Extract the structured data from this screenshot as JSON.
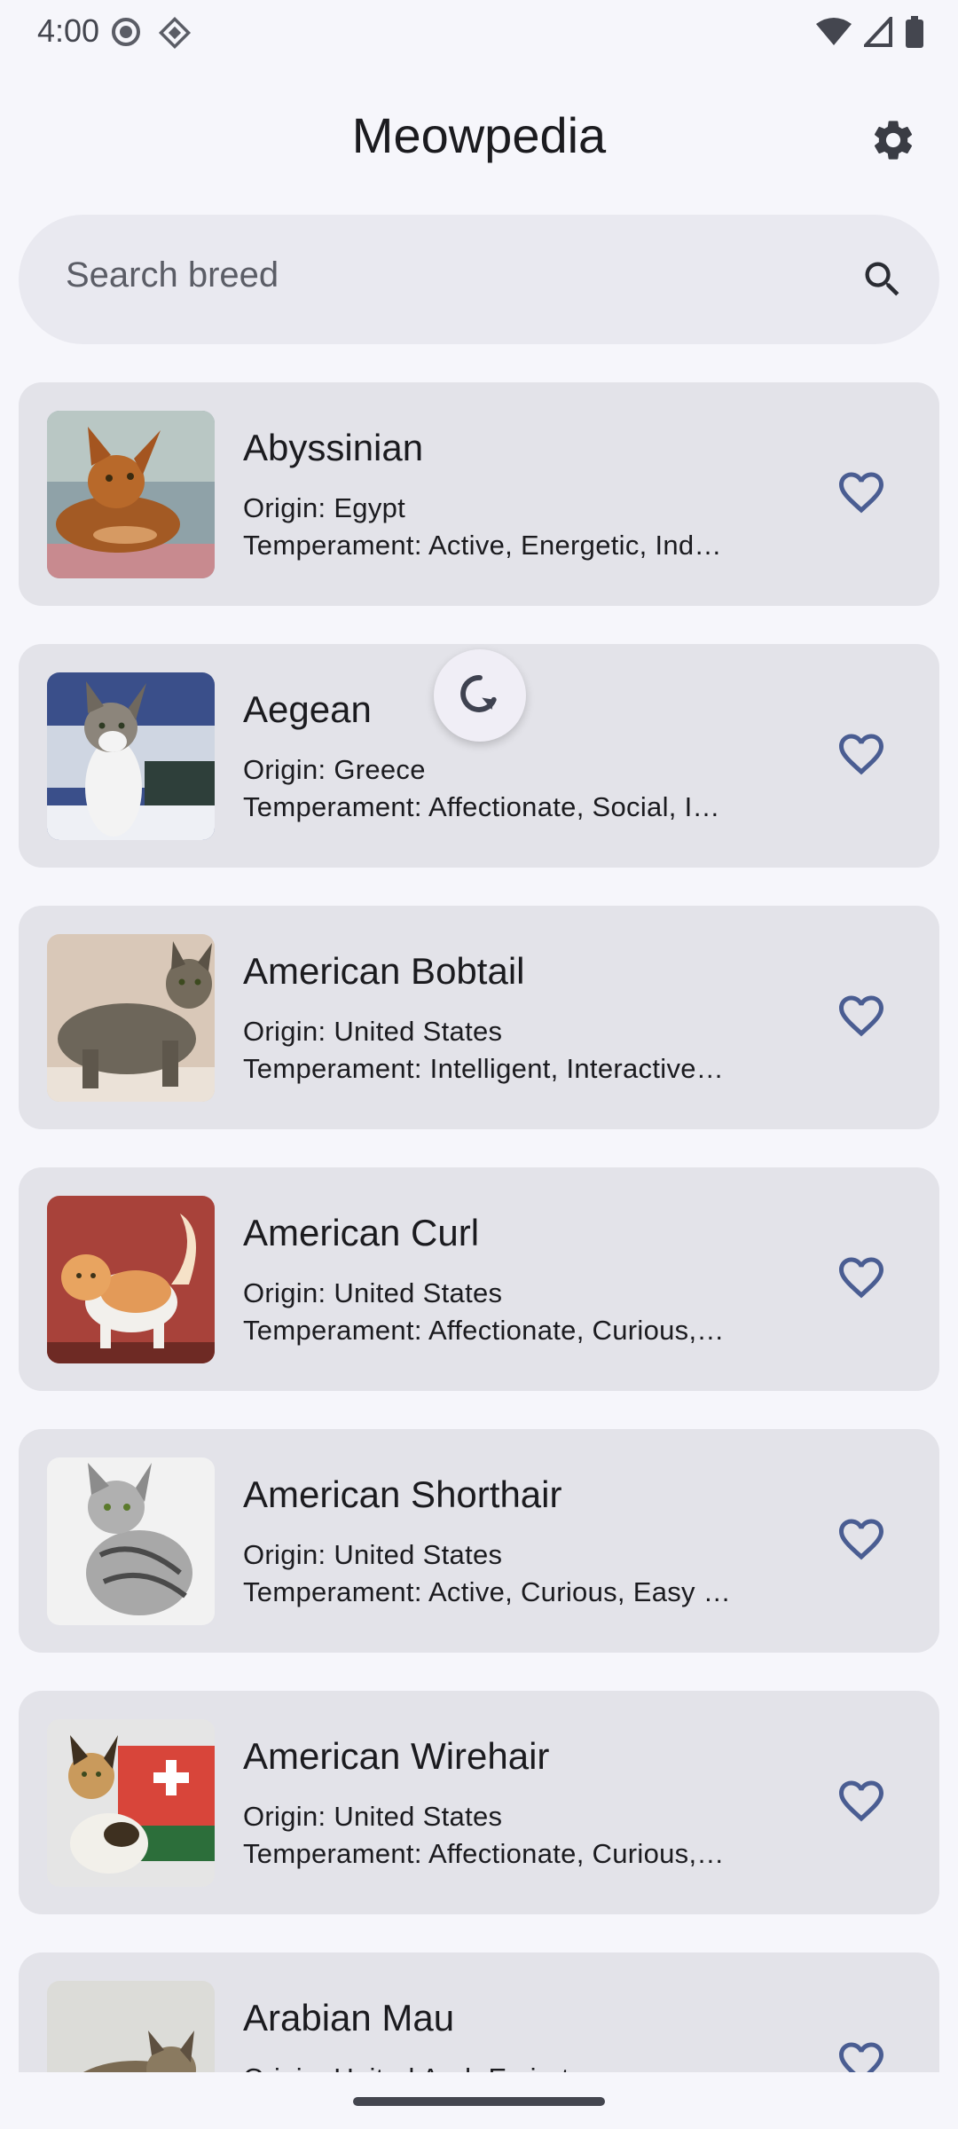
{
  "status_bar": {
    "time": "4:00",
    "icons": [
      "media-record-icon",
      "location-diamond-icon",
      "wifi-icon",
      "signal-icon",
      "battery-icon"
    ]
  },
  "header": {
    "title": "Meowpedia",
    "settings_icon": "gear-icon"
  },
  "search": {
    "placeholder": "Search breed",
    "icon": "search-icon"
  },
  "colors": {
    "background": "#f6f6fb",
    "card": "#e3e3e9",
    "search_bg": "#e9e9f0",
    "accent": "#4a5d92",
    "text": "#1b1b1f"
  },
  "breeds": [
    {
      "name": "Abyssinian",
      "origin": "Origin: Egypt",
      "temperament": "Temperament: Active, Energetic, Ind…",
      "favorite": false
    },
    {
      "name": "Aegean",
      "origin": "Origin: Greece",
      "temperament": "Temperament: Affectionate, Social, I…",
      "favorite": false
    },
    {
      "name": "American Bobtail",
      "origin": "Origin: United States",
      "temperament": "Temperament: Intelligent, Interactive…",
      "favorite": false
    },
    {
      "name": "American Curl",
      "origin": "Origin: United States",
      "temperament": "Temperament: Affectionate, Curious,…",
      "favorite": false
    },
    {
      "name": "American Shorthair",
      "origin": "Origin: United States",
      "temperament": "Temperament: Active, Curious, Easy …",
      "favorite": false
    },
    {
      "name": "American Wirehair",
      "origin": "Origin: United States",
      "temperament": "Temperament: Affectionate, Curious,…",
      "favorite": false
    },
    {
      "name": "Arabian Mau",
      "origin": "Origin: United Arab Emirates",
      "temperament": "",
      "favorite": false
    }
  ],
  "refresh_icon": "refresh-icon"
}
